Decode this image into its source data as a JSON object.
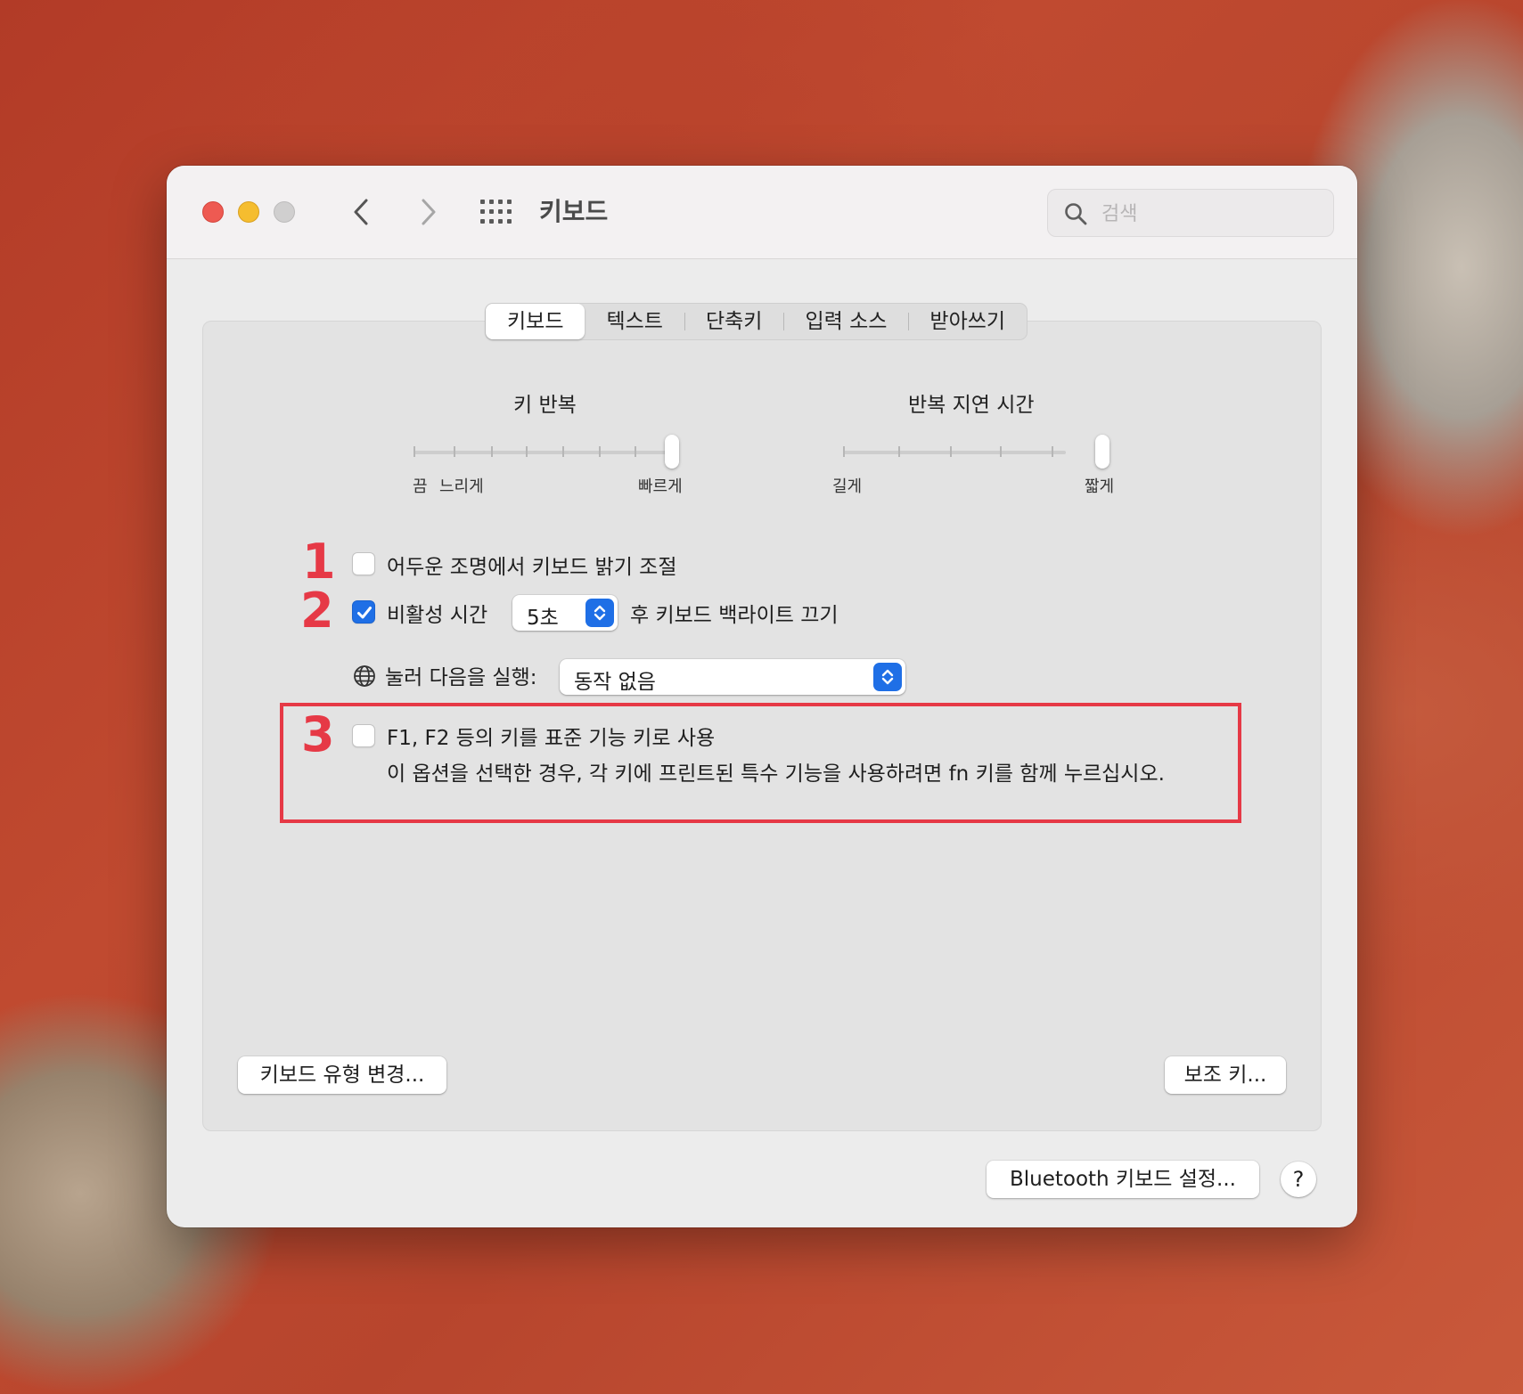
{
  "titlebar": {
    "title": "키보드",
    "search_placeholder": "검색",
    "icons": [
      "close-button",
      "minimize-button",
      "zoom-button",
      "chevron-left-icon",
      "chevron-right-icon",
      "grid-icon",
      "search-icon"
    ]
  },
  "tabs": [
    {
      "label": "키보드",
      "active": true
    },
    {
      "label": "텍스트",
      "active": false
    },
    {
      "label": "단축키",
      "active": false
    },
    {
      "label": "입력 소스",
      "active": false
    },
    {
      "label": "받아쓰기",
      "active": false
    }
  ],
  "key_repeat": {
    "label": "키 반복",
    "min_label": "끔",
    "slow_label": "느리게",
    "max_label": "빠르게",
    "value_fraction": 1.0
  },
  "delay_until_repeat": {
    "label": "반복 지연 시간",
    "min_label": "길게",
    "max_label": "짧게",
    "value_fraction": 1.0
  },
  "options": {
    "auto_brightness": {
      "label": "어두운 조명에서 키보드 밝기 조절",
      "checked": false,
      "annotation": "1"
    },
    "backlight_off": {
      "label_before": "비활성 시간",
      "popup_value": "5초",
      "label_after": "후 키보드 백라이트 끄기",
      "checked": true,
      "annotation": "2"
    },
    "globe_key": {
      "label": "눌러 다음을 실행:",
      "popup_value": "동작 없음",
      "icon": "globe-icon"
    },
    "fn_keys": {
      "label": "F1, F2 등의 키를 표준 기능 키로 사용",
      "description": "이 옵션을 선택한 경우, 각 키에 프린트된 특수 기능을 사용하려면 fn 키를 함께 누르십시오.",
      "checked": false,
      "annotation": "3"
    }
  },
  "buttons": {
    "change_type": "키보드 유형 변경...",
    "modifier_keys": "보조 키...",
    "bluetooth": "Bluetooth 키보드 설정...",
    "help": "?"
  },
  "colors": {
    "accent": "#1f6fe6",
    "annotation_red": "#e63946",
    "traffic_red": "#ee5a52",
    "traffic_yellow": "#f5bd2f"
  }
}
